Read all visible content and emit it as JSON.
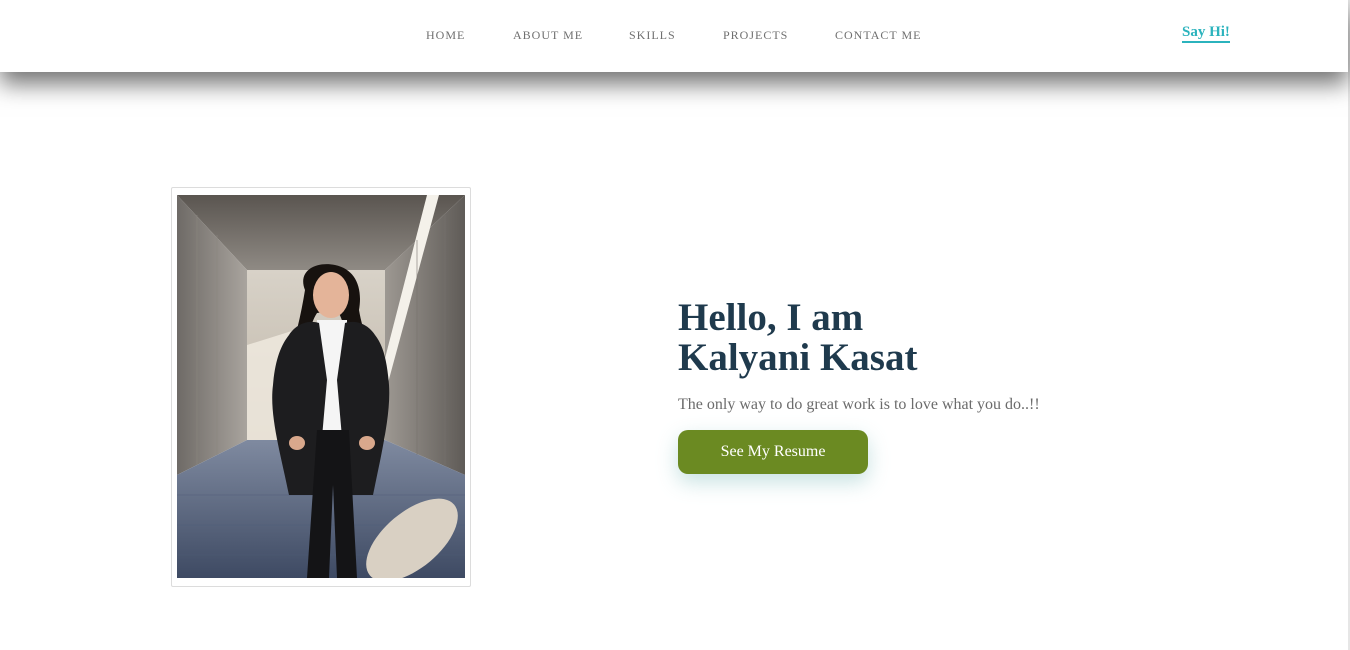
{
  "nav": {
    "links": [
      {
        "label": "HOME"
      },
      {
        "label": "ABOUT ME"
      },
      {
        "label": "SKILLS"
      },
      {
        "label": "PROJECTS"
      },
      {
        "label": "CONTACT ME"
      }
    ],
    "cta_label": "Say Hi!"
  },
  "hero": {
    "greeting_line1": "Hello, I am",
    "greeting_line2": "Kalyani Kasat",
    "tagline": "The only way to do great work is to love what you do..!!",
    "button_label": "See My Resume"
  },
  "colors": {
    "heading": "#1f3a4d",
    "accent": "#2bb3bd",
    "button": "#6b8a22",
    "nav_text": "#6f6f6f"
  }
}
